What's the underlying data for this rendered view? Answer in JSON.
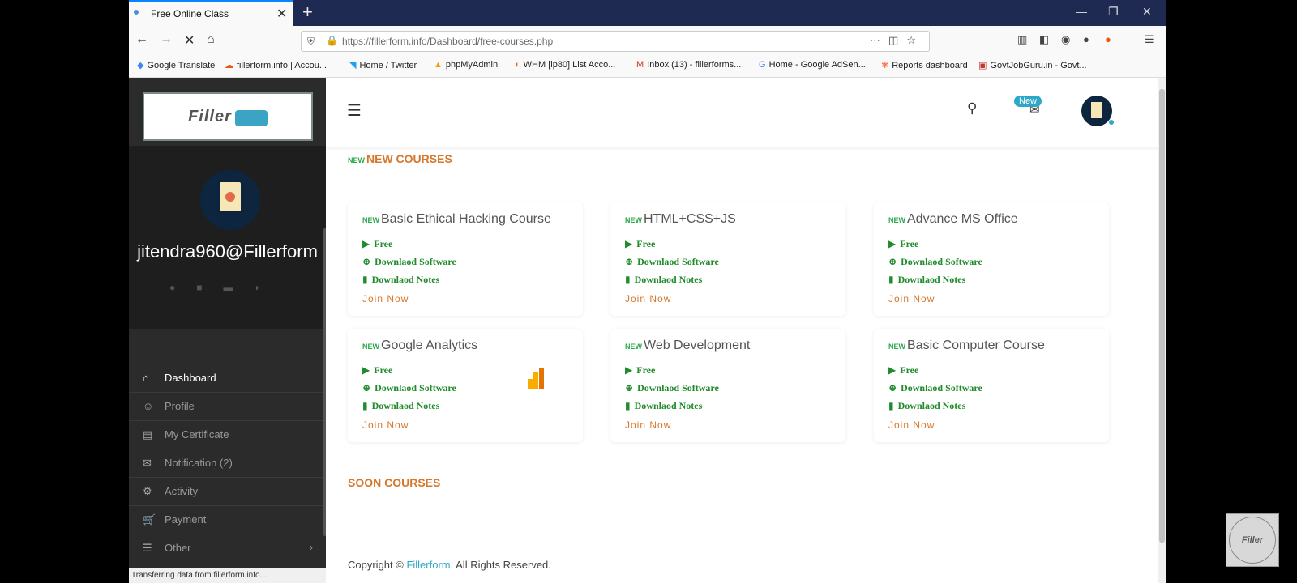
{
  "browser": {
    "tab_title": "Free Online Class",
    "url": "https://fillerform.info/Dashboard/free-courses.php",
    "bookmarks": [
      "Google Translate",
      "fillerform.info | Accou...",
      "Home / Twitter",
      "phpMyAdmin",
      "WHM [ip80] List Acco...",
      "Inbox (13) - fillerforms...",
      "Home - Google AdSen...",
      "Reports dashboard",
      "GovtJobGuru.in - Govt..."
    ],
    "status_text": "Transferring data from fillerform.info..."
  },
  "sidebar": {
    "logo_text": "Filler",
    "username": "jitendra960@Fillerform",
    "items": [
      {
        "label": "Dashboard",
        "icon": "home-icon"
      },
      {
        "label": "Profile",
        "icon": "user-icon"
      },
      {
        "label": "My Certificate",
        "icon": "certificate-icon"
      },
      {
        "label": "Notification (2)",
        "icon": "envelope-icon"
      },
      {
        "label": "Activity",
        "icon": "gear-icon"
      },
      {
        "label": "Payment",
        "icon": "cart-icon"
      },
      {
        "label": "Other",
        "icon": "list-icon"
      }
    ]
  },
  "header": {
    "new_badge": "New"
  },
  "sections": {
    "new_courses": "NEW COURSES",
    "soon_courses": "SOON COURSES",
    "new_tag": "NEW"
  },
  "courses": [
    {
      "title": "Basic Ethical Hacking Course",
      "free": "Free",
      "software": "Downlaod Software",
      "notes": "Downlaod Notes",
      "join": "Join Now"
    },
    {
      "title": "HTML+CSS+JS",
      "free": "Free",
      "software": "Downlaod Software",
      "notes": "Downlaod Notes",
      "join": "Join Now"
    },
    {
      "title": "Advance MS Office",
      "free": "Free",
      "software": "Downlaod Software",
      "notes": "Downlaod Notes",
      "join": "Join Now"
    },
    {
      "title": "Google Analytics",
      "free": "Free",
      "software": "Downlaod Software",
      "notes": "Downlaod Notes",
      "join": "Join Now"
    },
    {
      "title": "Web Development",
      "free": "Free",
      "software": "Downlaod Software",
      "notes": "Downlaod Notes",
      "join": "Join Now"
    },
    {
      "title": "Basic Computer Course",
      "free": "Free",
      "software": "Downlaod Software",
      "notes": "Downlaod Notes",
      "join": "Join Now"
    }
  ],
  "footer": {
    "prefix": "Copyright ©",
    "brand": "Fillerform",
    "suffix": ". All Rights Reserved."
  },
  "colors": {
    "accent_orange": "#d6772b",
    "link_green": "#1f8b2b",
    "brand_blue": "#2ea8c9",
    "sidebar_bg": "#2b2b2b"
  },
  "watermark_text": "Filler"
}
